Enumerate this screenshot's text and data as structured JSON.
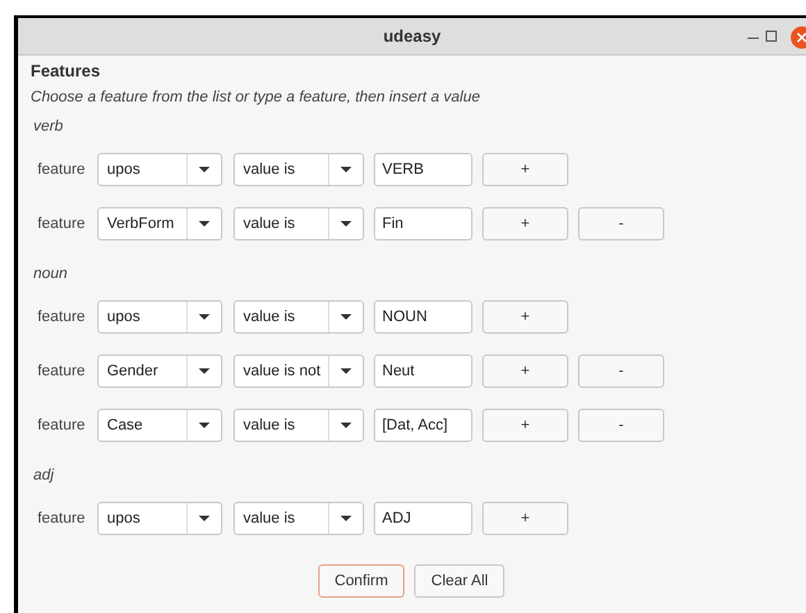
{
  "window": {
    "title": "udeasy"
  },
  "heading": "Features",
  "instructions": "Choose a feature from the list or type a feature, then insert a value",
  "groups": [
    {
      "name": "verb",
      "rows": [
        {
          "label": "feature",
          "feature": "upos",
          "operator": "value is",
          "value": "VERB",
          "add": "+"
        },
        {
          "label": "feature",
          "feature": "VerbForm",
          "operator": "value is",
          "value": "Fin",
          "add": "+",
          "remove": "-"
        }
      ]
    },
    {
      "name": "noun",
      "rows": [
        {
          "label": "feature",
          "feature": "upos",
          "operator": "value is",
          "value": "NOUN",
          "add": "+"
        },
        {
          "label": "feature",
          "feature": "Gender",
          "operator": "value is not",
          "value": "Neut",
          "add": "+",
          "remove": "-"
        },
        {
          "label": "feature",
          "feature": "Case",
          "operator": "value is",
          "value": "[Dat, Acc]",
          "add": "+",
          "remove": "-"
        }
      ]
    },
    {
      "name": "adj",
      "rows": [
        {
          "label": "feature",
          "feature": "upos",
          "operator": "value is",
          "value": "ADJ",
          "add": "+"
        }
      ]
    }
  ],
  "buttons": [
    {
      "label": "Confirm",
      "kind": "primary"
    },
    {
      "label": "Clear All",
      "kind": "secondary"
    }
  ]
}
